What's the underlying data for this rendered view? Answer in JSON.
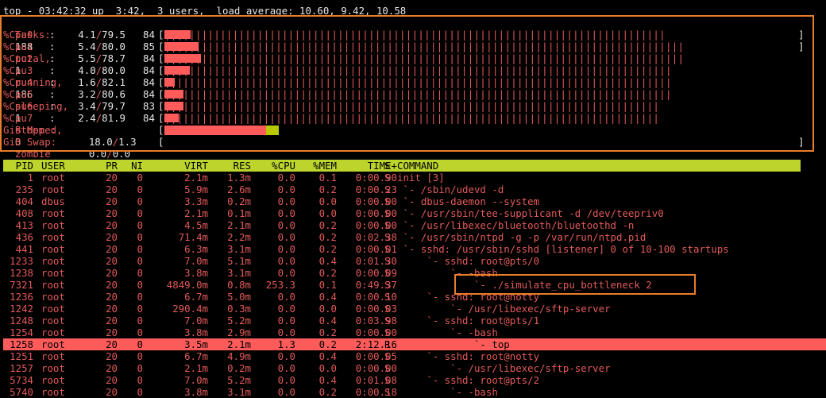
{
  "summary": {
    "uptime_line": "top - 03:42:32 up  3:42,  3 users,  load average: 10.60, 9.42, 10.58",
    "tasks_label": "Tasks:",
    "tasks_total": "188",
    "tasks_total_label": "total,",
    "tasks_running": "1",
    "tasks_running_label": "running,",
    "tasks_sleeping": "186",
    "tasks_sleeping_label": "sleeping,",
    "tasks_stopped": "1",
    "tasks_stopped_label": "stopped,",
    "tasks_zombie": "0",
    "tasks_zombie_label": "zombie"
  },
  "cpus": [
    {
      "label": "%Cpu0",
      "used": "4.1",
      "total": "79.5",
      "pct": "84",
      "fill": 0.041
    },
    {
      "label": "%Cpu1",
      "used": "5.4",
      "total": "80.0",
      "pct": "85",
      "fill": 0.054
    },
    {
      "label": "%Cpu2",
      "used": "5.5",
      "total": "78.7",
      "pct": "84",
      "fill": 0.058
    },
    {
      "label": "%Cpu3",
      "used": "4.0",
      "total": "80.0",
      "pct": "84",
      "fill": 0.04
    },
    {
      "label": "%Cpu4",
      "used": "1.6",
      "total": "82.1",
      "pct": "84",
      "fill": 0.016
    },
    {
      "label": "%Cpu5",
      "used": "3.2",
      "total": "80.6",
      "pct": "84",
      "fill": 0.03
    },
    {
      "label": "%Cpu6",
      "used": "3.4",
      "total": "79.7",
      "pct": "83",
      "fill": 0.03
    },
    {
      "label": "%Cpu7",
      "used": "2.4",
      "total": "81.9",
      "pct": "84",
      "fill": 0.022
    }
  ],
  "cpu_bar_lengths": [
    81,
    84,
    84,
    82,
    82,
    82,
    80,
    80
  ],
  "mem": {
    "label": "GiB Mem :",
    "used": "18.0",
    "total": "1.3",
    "fill_red": 0.16,
    "fill_yellow": 0.02
  },
  "swap": {
    "label": "GiB Swap:",
    "used": "0.0",
    "total": "0.0"
  },
  "table": {
    "headers": {
      "pid": "PID",
      "user": "USER",
      "pr": "PR",
      "ni": "NI",
      "virt": "VIRT",
      "res": "RES",
      "cpu": "%CPU",
      "mem": "%MEM",
      "time": "TIME+",
      "s": "S",
      "cmd": "COMMAND"
    },
    "rows": [
      {
        "pid": "1",
        "user": "root",
        "pr": "20",
        "ni": "0",
        "virt": "2.1m",
        "res": "1.3m",
        "cpu": "0.0",
        "mem": "0.1",
        "time": "0:00.90",
        "s": "S",
        "cmd": "init [3]"
      },
      {
        "pid": "235",
        "user": "root",
        "pr": "20",
        "ni": "0",
        "virt": "5.9m",
        "res": "2.6m",
        "cpu": "0.0",
        "mem": "0.2",
        "time": "0:00.23",
        "s": "S",
        "cmd": " `- /sbin/udevd -d"
      },
      {
        "pid": "404",
        "user": "dbus",
        "pr": "20",
        "ni": "0",
        "virt": "3.3m",
        "res": "0.2m",
        "cpu": "0.0",
        "mem": "0.0",
        "time": "0:00.00",
        "s": "S",
        "cmd": " `- dbus-daemon --system"
      },
      {
        "pid": "408",
        "user": "root",
        "pr": "20",
        "ni": "0",
        "virt": "2.1m",
        "res": "0.1m",
        "cpu": "0.0",
        "mem": "0.0",
        "time": "0:00.00",
        "s": "S",
        "cmd": " `- /usr/sbin/tee-supplicant -d /dev/teepriv0"
      },
      {
        "pid": "413",
        "user": "root",
        "pr": "20",
        "ni": "0",
        "virt": "4.5m",
        "res": "2.1m",
        "cpu": "0.0",
        "mem": "0.2",
        "time": "0:00.00",
        "s": "S",
        "cmd": " `- /usr/libexec/bluetooth/bluetoothd -n"
      },
      {
        "pid": "436",
        "user": "root",
        "pr": "20",
        "ni": "0",
        "virt": "71.4m",
        "res": "2.2m",
        "cpu": "0.0",
        "mem": "0.2",
        "time": "0:02.38",
        "s": "S",
        "cmd": " `- /usr/sbin/ntpd -g -p /var/run/ntpd.pid"
      },
      {
        "pid": "441",
        "user": "root",
        "pr": "20",
        "ni": "0",
        "virt": "6.3m",
        "res": "3.1m",
        "cpu": "0.0",
        "mem": "0.2",
        "time": "0:00.01",
        "s": "S",
        "cmd": " `- sshd: /usr/sbin/sshd [listener] 0 of 10-100 startups"
      },
      {
        "pid": "1233",
        "user": "root",
        "pr": "20",
        "ni": "0",
        "virt": "7.0m",
        "res": "5.1m",
        "cpu": "0.0",
        "mem": "0.4",
        "time": "0:01.30",
        "s": "S",
        "cmd": "     `- sshd: root@pts/0"
      },
      {
        "pid": "1238",
        "user": "root",
        "pr": "20",
        "ni": "0",
        "virt": "3.8m",
        "res": "3.1m",
        "cpu": "0.0",
        "mem": "0.2",
        "time": "0:00.09",
        "s": "S",
        "cmd": "         `- -bash"
      },
      {
        "pid": "7321",
        "user": "root",
        "pr": "20",
        "ni": "0",
        "virt": "4849.0m",
        "res": "0.8m",
        "cpu": "253.3",
        "mem": "0.1",
        "time": "0:49.37",
        "s": "S",
        "cmd": "             `- ./simulate_cpu_bottleneck 2"
      },
      {
        "pid": "1236",
        "user": "root",
        "pr": "20",
        "ni": "0",
        "virt": "6.7m",
        "res": "5.0m",
        "cpu": "0.0",
        "mem": "0.4",
        "time": "0:00.10",
        "s": "S",
        "cmd": "     `- sshd: root@notty"
      },
      {
        "pid": "1242",
        "user": "root",
        "pr": "20",
        "ni": "0",
        "virt": "290.4m",
        "res": "0.3m",
        "cpu": "0.0",
        "mem": "0.0",
        "time": "0:00.03",
        "s": "S",
        "cmd": "         `- /usr/libexec/sftp-server"
      },
      {
        "pid": "1248",
        "user": "root",
        "pr": "20",
        "ni": "0",
        "virt": "7.0m",
        "res": "5.2m",
        "cpu": "0.0",
        "mem": "0.4",
        "time": "0:03.98",
        "s": "S",
        "cmd": "     `- sshd: root@pts/1"
      },
      {
        "pid": "1254",
        "user": "root",
        "pr": "20",
        "ni": "0",
        "virt": "3.8m",
        "res": "2.9m",
        "cpu": "0.0",
        "mem": "0.2",
        "time": "0:00.00",
        "s": "S",
        "cmd": "         `- -bash"
      },
      {
        "pid": "1258",
        "user": "root",
        "pr": "20",
        "ni": "0",
        "virt": "3.5m",
        "res": "2.1m",
        "cpu": "1.3",
        "mem": "0.2",
        "time": "2:12.16",
        "s": "R",
        "cmd": "             `- top"
      },
      {
        "pid": "1251",
        "user": "root",
        "pr": "20",
        "ni": "0",
        "virt": "6.7m",
        "res": "4.9m",
        "cpu": "0.0",
        "mem": "0.4",
        "time": "0:00.05",
        "s": "S",
        "cmd": "     `- sshd: root@notty"
      },
      {
        "pid": "1257",
        "user": "root",
        "pr": "20",
        "ni": "0",
        "virt": "2.1m",
        "res": "0.2m",
        "cpu": "0.0",
        "mem": "0.0",
        "time": "0:00.00",
        "s": "S",
        "cmd": "         `- /usr/libexec/sftp-server"
      },
      {
        "pid": "5734",
        "user": "root",
        "pr": "20",
        "ni": "0",
        "virt": "7.0m",
        "res": "5.2m",
        "cpu": "0.0",
        "mem": "0.4",
        "time": "0:01.08",
        "s": "S",
        "cmd": "     `- sshd: root@pts/2"
      },
      {
        "pid": "5740",
        "user": "root",
        "pr": "20",
        "ni": "0",
        "virt": "3.8m",
        "res": "3.1m",
        "cpu": "0.0",
        "mem": "0.2",
        "time": "0:00.18",
        "s": "S",
        "cmd": "         `- -bash"
      }
    ],
    "selected_pid": "1258"
  },
  "colors": {
    "accent_red": "#e35a5a",
    "bar_red": "#ff5b5b",
    "header_yellow": "#bcd42c",
    "mem_yellow": "#b9c900",
    "annotation_orange": "#e87d2a"
  }
}
